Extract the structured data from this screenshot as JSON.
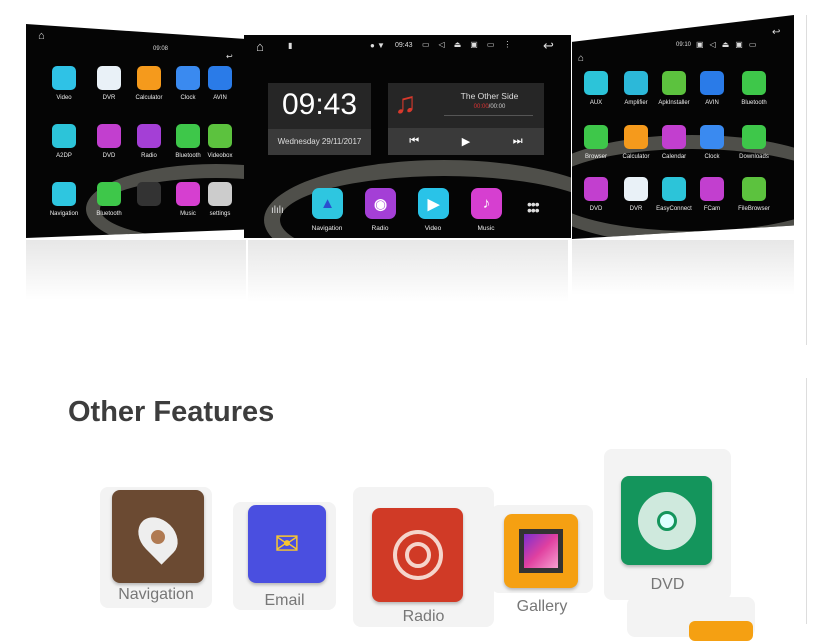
{
  "center_screen": {
    "status_time": "09:43",
    "clock": "09:43",
    "date": "Wednesday 29/11/2017",
    "track_title": "The Other Side",
    "track_elapsed": "00:00",
    "track_total": "/00:00",
    "dock": [
      {
        "label": "Navigation",
        "icon": "navigation-arrow-icon",
        "color": "#2ec6e0"
      },
      {
        "label": "Radio",
        "icon": "podcast-icon",
        "color": "#a43fd6"
      },
      {
        "label": "Video",
        "icon": "clapperboard-icon",
        "color": "#29c3e8"
      },
      {
        "label": "Music",
        "icon": "music-note-icon",
        "color": "#d63fd0"
      }
    ]
  },
  "left_screen": {
    "status_time": "09:08",
    "apps": [
      {
        "label": "Video",
        "color": "#2fc2e6"
      },
      {
        "label": "DVR",
        "color": "#e9f1f7"
      },
      {
        "label": "Calculator",
        "color": "#f59a1c"
      },
      {
        "label": "Clock",
        "color": "#3a8af0"
      },
      {
        "label": "AVIN",
        "color": "#2a7be8"
      },
      {
        "label": "A2DP",
        "color": "#2cc4d9"
      },
      {
        "label": "DVD",
        "color": "#c23fcf"
      },
      {
        "label": "Radio",
        "color": "#a43fd6"
      },
      {
        "label": "Bluetooth",
        "color": "#3ec74a"
      },
      {
        "label": "Videobox",
        "color": "#5cc23e"
      },
      {
        "label": "Navigation",
        "color": "#2ec6e0"
      },
      {
        "label": "Bluetooth",
        "color": "#3ec74a"
      },
      {
        "label": "",
        "color": "#333333"
      },
      {
        "label": "Music",
        "color": "#d63fd0"
      },
      {
        "label": "settings",
        "color": "#cccccc"
      }
    ]
  },
  "right_screen": {
    "status_time": "09:10",
    "apps": [
      {
        "label": "AUX",
        "color": "#2cc4d9"
      },
      {
        "label": "Amplifier",
        "color": "#2cb8d9"
      },
      {
        "label": "ApkInstaller",
        "color": "#5cc23e"
      },
      {
        "label": "AVIN",
        "color": "#2a7be8"
      },
      {
        "label": "Bluetooth",
        "color": "#3ec74a"
      },
      {
        "label": "Browser",
        "color": "#3ec74a"
      },
      {
        "label": "Calculator",
        "color": "#f59a1c"
      },
      {
        "label": "Calendar",
        "color": "#c23fcf"
      },
      {
        "label": "Clock",
        "color": "#3a8af0"
      },
      {
        "label": "Downloads",
        "color": "#3ec74a"
      },
      {
        "label": "DVD",
        "color": "#c23fcf"
      },
      {
        "label": "DVR",
        "color": "#e9f1f7"
      },
      {
        "label": "EasyConnect",
        "color": "#2cc4d9"
      },
      {
        "label": "FCam",
        "color": "#c23fcf"
      },
      {
        "label": "FileBrowser",
        "color": "#5cc23e"
      }
    ]
  },
  "features": {
    "title": "Other Features",
    "items": [
      {
        "label": "Navigation",
        "icon": "map-pin-icon",
        "color": "#6b4a32"
      },
      {
        "label": "Email",
        "icon": "envelope-icon",
        "color": "#4a4fe0"
      },
      {
        "label": "Radio",
        "icon": "radio-signal-icon",
        "color": "#d03a26"
      },
      {
        "label": "Gallery",
        "icon": "picture-frame-icon",
        "color": "#f5a012"
      },
      {
        "label": "DVD",
        "icon": "disc-icon",
        "color": "#14955c"
      }
    ]
  }
}
